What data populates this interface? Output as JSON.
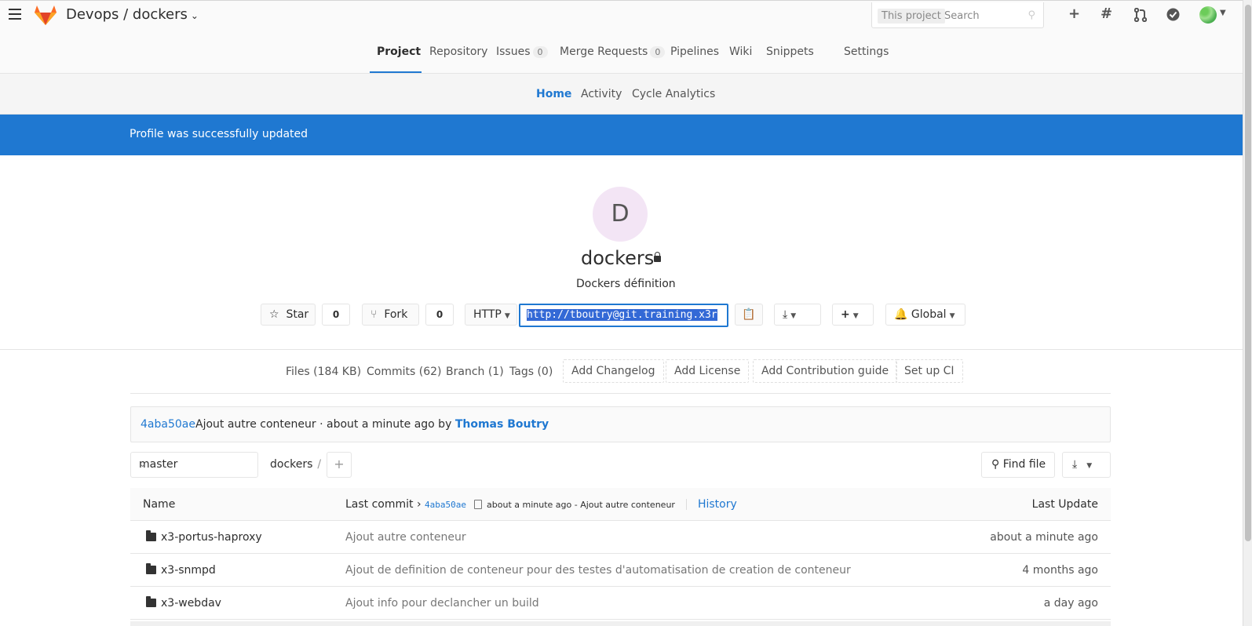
{
  "header": {
    "project_path": "Devops / dockers",
    "search": {
      "scope": "This project",
      "placeholder": "Search"
    },
    "icons": [
      "plus-icon",
      "hash-icon",
      "merge-request-icon",
      "todo-check-icon",
      "user-avatar"
    ]
  },
  "main_nav": {
    "items": [
      {
        "label": "Project",
        "active": true
      },
      {
        "label": "Repository"
      },
      {
        "label": "Issues",
        "badge": "0"
      },
      {
        "label": "Merge Requests",
        "badge": "0"
      },
      {
        "label": "Pipelines"
      },
      {
        "label": "Wiki"
      },
      {
        "label": "Snippets"
      },
      {
        "label": "Settings"
      }
    ]
  },
  "sub_nav": {
    "items": [
      {
        "label": "Home",
        "active": true
      },
      {
        "label": "Activity"
      },
      {
        "label": "Cycle Analytics"
      }
    ]
  },
  "flash": {
    "message": "Profile was successfully updated"
  },
  "project": {
    "avatar_letter": "D",
    "name": "dockers",
    "description": "Dockers définition",
    "star_label": "Star",
    "star_count": "0",
    "fork_label": "Fork",
    "fork_count": "0",
    "clone_protocol": "HTTP",
    "clone_url": "http://tboutry@git.training.x3r",
    "notification_level": "Global"
  },
  "stats": {
    "files": "Files (184 KB)",
    "commits": "Commits (62)",
    "branches": "Branch (1)",
    "tags": "Tags (0)",
    "add_changelog": "Add Changelog",
    "add_license": "Add License",
    "add_contribution": "Add Contribution guide",
    "setup_ci": "Set up CI"
  },
  "last_commit": {
    "sha": "4aba50ae",
    "message": "Ajout autre conteneur · about a minute ago by ",
    "author": "Thomas Boutry"
  },
  "tree": {
    "branch": "master",
    "path": "dockers",
    "path_sep": "/",
    "find_file": "Find file"
  },
  "table": {
    "headers": {
      "name": "Name",
      "last_commit": "Last commit",
      "sha": "4aba50ae",
      "commit_info": "about a minute ago - Ajout autre conteneur",
      "history": "History",
      "last_update": "Last Update"
    },
    "rows": [
      {
        "name": "x3-portus-haproxy",
        "message": "Ajout autre conteneur",
        "updated": "about a minute ago"
      },
      {
        "name": "x3-snmpd",
        "message": "Ajout de definition de conteneur pour des testes d'automatisation de creation de conteneur",
        "updated": "4 months ago"
      },
      {
        "name": "x3-webdav",
        "message": "Ajout info pour declancher un build",
        "updated": "a day ago"
      }
    ]
  },
  "colors": {
    "accent": "#1f78d1",
    "flash_bg": "#1f78d1",
    "avatar_bg": "#f3e5f5"
  }
}
